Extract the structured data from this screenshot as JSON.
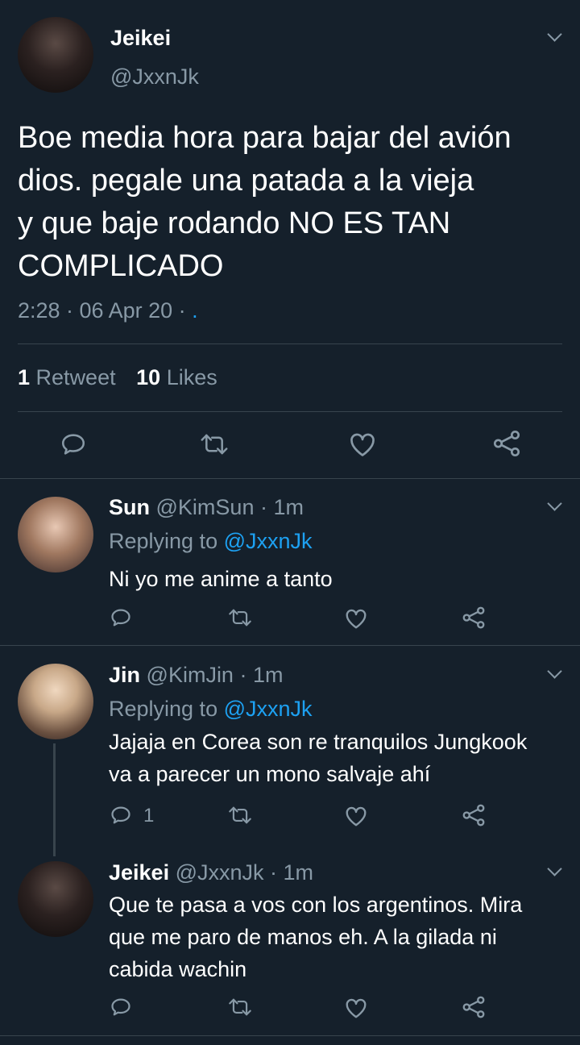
{
  "main_tweet": {
    "display_name": "Jeikei",
    "handle": "@JxxnJk",
    "text_lines": [
      "Boe media hora para bajar del avión",
      "dios. pegale una patada a la vieja",
      "y que baje rodando NO ES TAN",
      "COMPLICADO"
    ],
    "timestamp": "2:28 · 06 Apr 20 · ",
    "source_dot": ".",
    "retweets_count": "1",
    "retweets_label": "Retweet",
    "likes_count": "10",
    "likes_label": "Likes"
  },
  "replies": [
    {
      "display_name": "Sun",
      "handle_time": "@KimSun · 1m",
      "replying_prefix": "Replying to",
      "replying_to": "@JxxnJk",
      "text_lines": [
        "Ni yo me anime a tanto"
      ],
      "reply_count": ""
    },
    {
      "display_name": "Jin",
      "handle_time": "@KimJin · 1m",
      "replying_prefix": "Replying to",
      "replying_to": "@JxxnJk",
      "text_lines": [
        "Jajaja en Corea son re tranquilos Jungkook",
        "va a parecer un mono salvaje ahí"
      ],
      "reply_count": "1"
    },
    {
      "display_name": "Jeikei",
      "handle_time": "@JxxnJk · 1m",
      "text_lines": [
        "Que te pasa a vos con los argentinos. Mira",
        "que me paro de manos eh. A la gilada ni",
        "cabida wachin"
      ],
      "reply_count": ""
    }
  ],
  "colors": {
    "background": "#15202b",
    "text": "#ffffff",
    "muted": "#8899a6",
    "accent": "#1da1f2",
    "divider": "#38444d"
  },
  "icons": [
    "reply-icon",
    "retweet-icon",
    "like-icon",
    "share-icon",
    "chevron-down-icon"
  ]
}
